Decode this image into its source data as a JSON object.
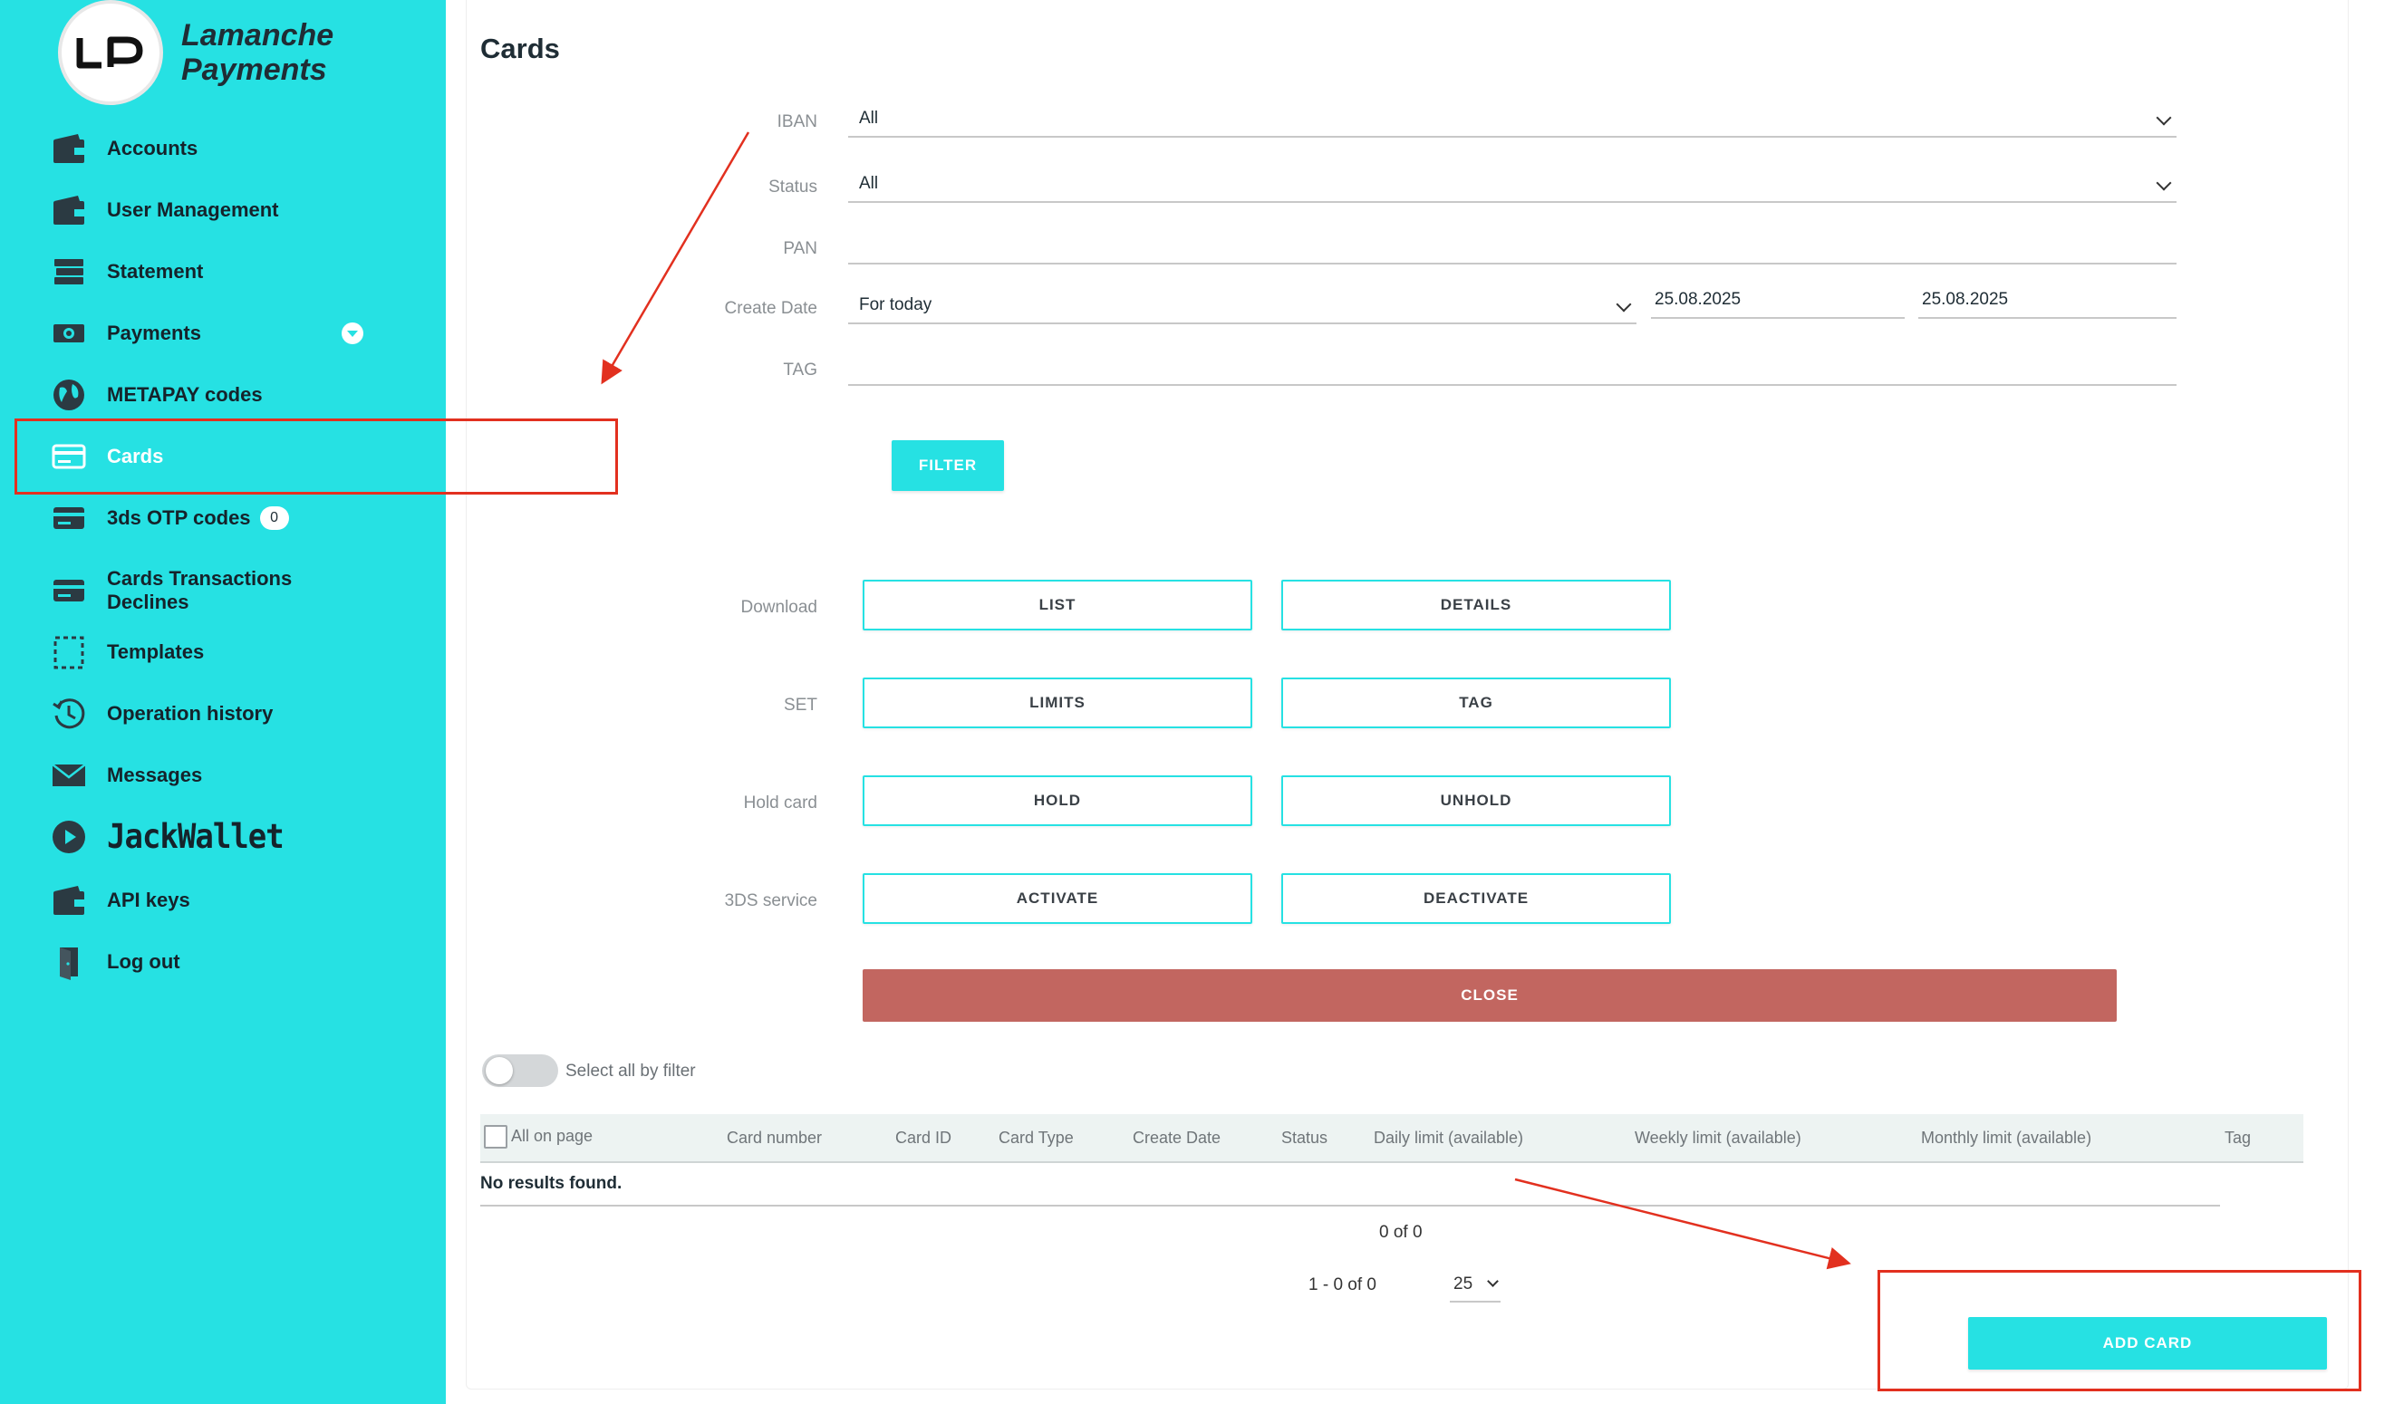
{
  "brand": {
    "line1": "Lamanche",
    "line2": "Payments"
  },
  "sidebar": {
    "items": [
      {
        "label": "Accounts",
        "icon": "wallet-icon"
      },
      {
        "label": "User Management",
        "icon": "wallet-icon"
      },
      {
        "label": "Statement",
        "icon": "stack-icon"
      },
      {
        "label": "Payments",
        "icon": "cash-icon"
      },
      {
        "label": "METAPAY codes",
        "icon": "globe-icon"
      },
      {
        "label": "Cards",
        "icon": "card-icon",
        "active": true
      },
      {
        "label": "3ds OTP codes",
        "icon": "card-icon",
        "badge": "0"
      },
      {
        "label": "Cards Transactions Declines",
        "icon": "card-icon"
      },
      {
        "label": "Templates",
        "icon": "dashed-square-icon"
      },
      {
        "label": "Operation history",
        "icon": "history-icon"
      },
      {
        "label": "Messages",
        "icon": "envelope-icon"
      },
      {
        "label": "JackWallet",
        "icon": "play-icon"
      },
      {
        "label": "API keys",
        "icon": "wallet-icon"
      },
      {
        "label": "Log out",
        "icon": "door-icon"
      }
    ]
  },
  "page": {
    "title": "Cards"
  },
  "filters": {
    "iban": {
      "label": "IBAN",
      "value": "All"
    },
    "status": {
      "label": "Status",
      "value": "All"
    },
    "pan": {
      "label": "PAN",
      "value": ""
    },
    "create_date": {
      "label": "Create Date",
      "value": "For today",
      "from": "25.08.2025",
      "to": "25.08.2025"
    },
    "tag": {
      "label": "TAG",
      "value": ""
    },
    "filter_button": "FILTER"
  },
  "actions": {
    "download": {
      "label": "Download",
      "buttons": [
        "LIST",
        "DETAILS"
      ]
    },
    "set": {
      "label": "SET",
      "buttons": [
        "LIMITS",
        "TAG"
      ]
    },
    "hold": {
      "label": "Hold card",
      "buttons": [
        "HOLD",
        "UNHOLD"
      ]
    },
    "threeds": {
      "label": "3DS service",
      "buttons": [
        "ACTIVATE",
        "DEACTIVATE"
      ]
    },
    "close_button": "CLOSE"
  },
  "select_all_by_filter": "Select all by filter",
  "table": {
    "select_all_label": "All on page",
    "columns": [
      "Card number",
      "Card ID",
      "Card Type",
      "Create Date",
      "Status",
      "Daily limit (available)",
      "Weekly limit (available)",
      "Monthly limit (available)",
      "Tag"
    ],
    "empty_text": "No results found."
  },
  "pagination": {
    "count": "0 of 0",
    "range": "1 - 0 of 0",
    "page_size": "25"
  },
  "add_card_button": "ADD CARD",
  "colors": {
    "accent": "#26e1e3",
    "close": "#c26660",
    "annotation": "#e2301f"
  }
}
